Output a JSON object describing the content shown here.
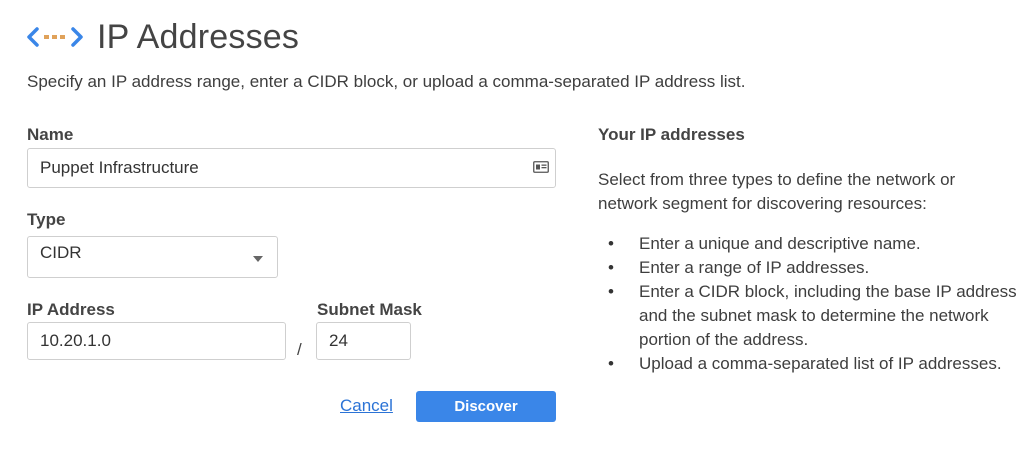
{
  "header": {
    "title": "IP Addresses",
    "logo_icon": "network-brackets-icon",
    "colors": {
      "bracket": "#3a86e8",
      "dots": "#e0a25a"
    }
  },
  "intro_text": "Specify an IP address range, enter a CIDR block, or upload a comma-separated IP address list.",
  "form": {
    "name": {
      "label": "Name",
      "value": "Puppet Infrastructure",
      "icon": "contact-card-icon"
    },
    "type": {
      "label": "Type",
      "value": "CIDR",
      "icon": "caret-down-icon"
    },
    "ip_address": {
      "label": "IP Address",
      "value": "10.20.1.0"
    },
    "separator": "/",
    "subnet_mask": {
      "label": "Subnet Mask",
      "value": "24"
    },
    "cancel_label": "Cancel",
    "discover_label": "Discover"
  },
  "help": {
    "title": "Your IP addresses",
    "intro": "Select from three types to define the network or network segment for discovering resources:",
    "items": [
      "Enter a unique and descriptive name.",
      "Enter a range of IP addresses.",
      "Enter a CIDR block, including the base IP address and the subnet mask to determine the network portion of the address.",
      "Upload a comma-separated list of IP addresses."
    ]
  },
  "colors": {
    "primary_button": "#3a86e8",
    "link": "#2b73d6"
  }
}
